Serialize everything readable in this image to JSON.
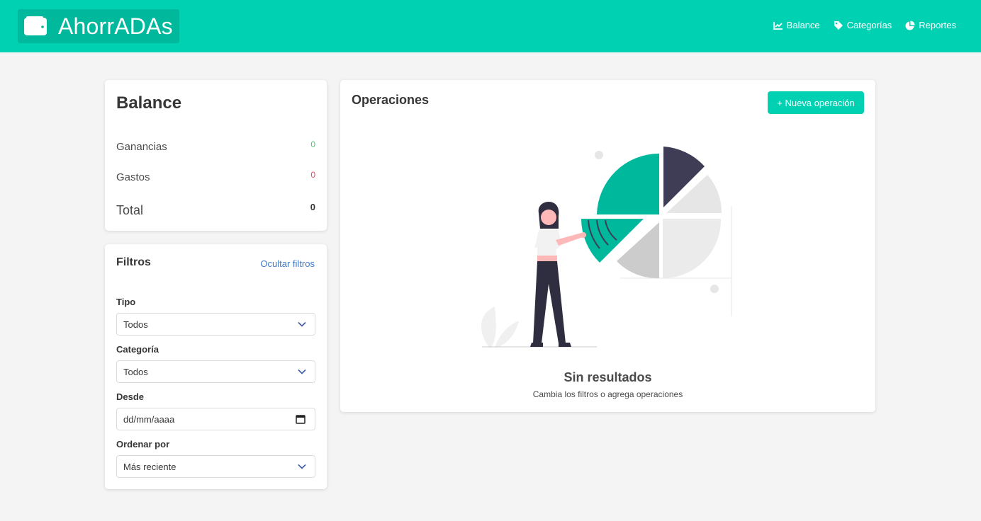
{
  "brand": {
    "title": "AhorrADAs",
    "icon": "wallet-icon"
  },
  "nav": [
    {
      "label": "Balance",
      "icon": "chart-line-icon"
    },
    {
      "label": "Categorías",
      "icon": "tag-icon"
    },
    {
      "label": "Reportes",
      "icon": "pie-chart-icon"
    }
  ],
  "balance": {
    "title": "Balance",
    "rows": [
      {
        "label": "Ganancias",
        "value": "0",
        "color": "#48c774"
      },
      {
        "label": "Gastos",
        "value": "0",
        "color": "#f14668"
      },
      {
        "label": "Total",
        "value": "0",
        "color": "#363636"
      }
    ]
  },
  "filters": {
    "title": "Filtros",
    "hide_label": "Ocultar filtros",
    "fields": [
      {
        "label": "Tipo",
        "value": "Todos",
        "kind": "select"
      },
      {
        "label": "Categoría",
        "value": "Todos",
        "kind": "select"
      },
      {
        "label": "Desde",
        "value": "dd/mm/aaaa",
        "kind": "date"
      },
      {
        "label": "Ordenar por",
        "value": "Más reciente",
        "kind": "select"
      }
    ]
  },
  "operations": {
    "title": "Operaciones",
    "new_button": "+ Nueva operación",
    "empty_title": "Sin resultados",
    "empty_subtitle": "Cambia los filtros o agrega operaciones"
  },
  "colors": {
    "accent": "#00d1b2",
    "accent_dark": "#00b89c",
    "link": "#3e7ac9"
  }
}
